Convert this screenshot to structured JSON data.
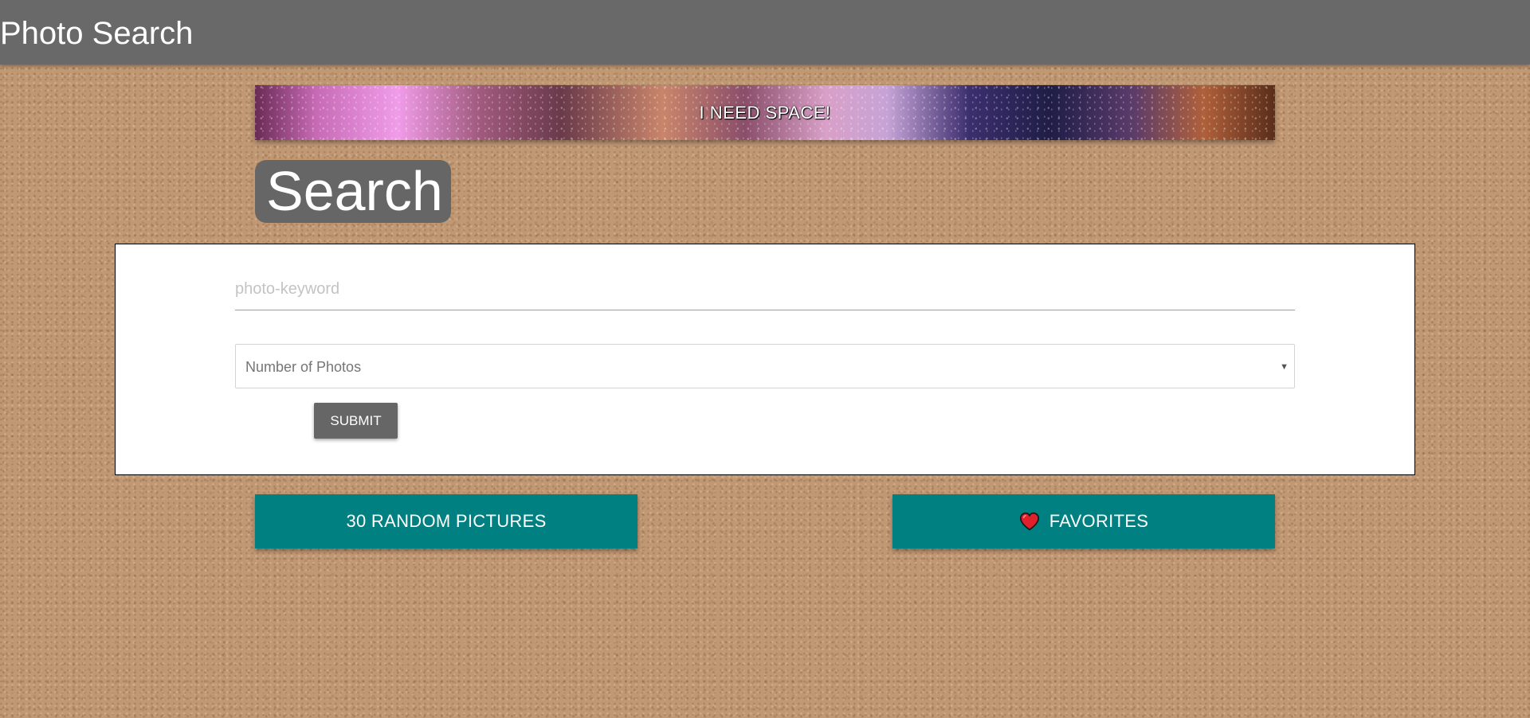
{
  "header": {
    "title": "Photo Search"
  },
  "banner": {
    "text": "I NEED SPACE!"
  },
  "search": {
    "heading": "Search",
    "keyword_placeholder": "photo-keyword",
    "keyword_value": "",
    "count_select_value": "Number of Photos",
    "submit_label": "SUBMIT"
  },
  "actions": {
    "random_label": "30 RANDOM PICTURES",
    "favorites_label": "FAVORITES",
    "favorites_icon": "heart-icon"
  },
  "colors": {
    "topbar": "#696969",
    "accent": "#008080",
    "submit": "#666666",
    "heart": "#e0202a"
  }
}
